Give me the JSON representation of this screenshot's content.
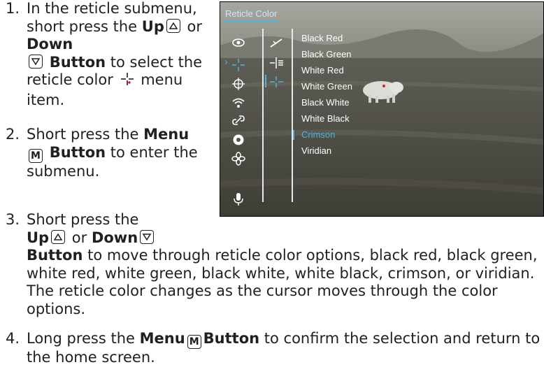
{
  "steps": [
    {
      "number": "1.",
      "pre": "In the reticle submenu, short press the ",
      "up": "Up",
      "or": " or ",
      "down": "Down",
      "button": "Button",
      "mid": " to select the reticle color ",
      "post": " menu item."
    },
    {
      "number": "2.",
      "pre": "Short press the ",
      "menu": "Menu",
      "button": "Button",
      "post": " to enter the submenu.",
      "key_letter": "M"
    },
    {
      "number": "3.",
      "pre": "Short press the",
      "up": "Up",
      "or": " or ",
      "down": "Down",
      "button": "Button",
      "post": " to move through reticle color options, black red, black green, white red, white green, black white, white black, crimson, or viridian. The reticle color changes as the cursor moves through the color options."
    },
    {
      "number": "4.",
      "pre": "Long press the ",
      "menu": "Menu",
      "button": "Button",
      "post": " to confirm the selection and return to the home screen.",
      "key_letter": "M"
    }
  ],
  "device_screen": {
    "title": "Reticle Color",
    "options": [
      "Black Red",
      "Black Green",
      "White Red",
      "White Green",
      "Black White",
      "White Black",
      "Crimson",
      "Viridian"
    ],
    "selected": "Crimson",
    "accent_color": "#49b7e3",
    "left_icons": [
      "eye-icon",
      "reticle-icon",
      "crosshair-target-icon",
      "wifi-icon",
      "link-icon",
      "aperture-icon",
      "fan-icon",
      "microphone-icon"
    ],
    "second_icons": [
      "zeroing-icon",
      "reticle-type-icon",
      "reticle-color-icon"
    ]
  }
}
